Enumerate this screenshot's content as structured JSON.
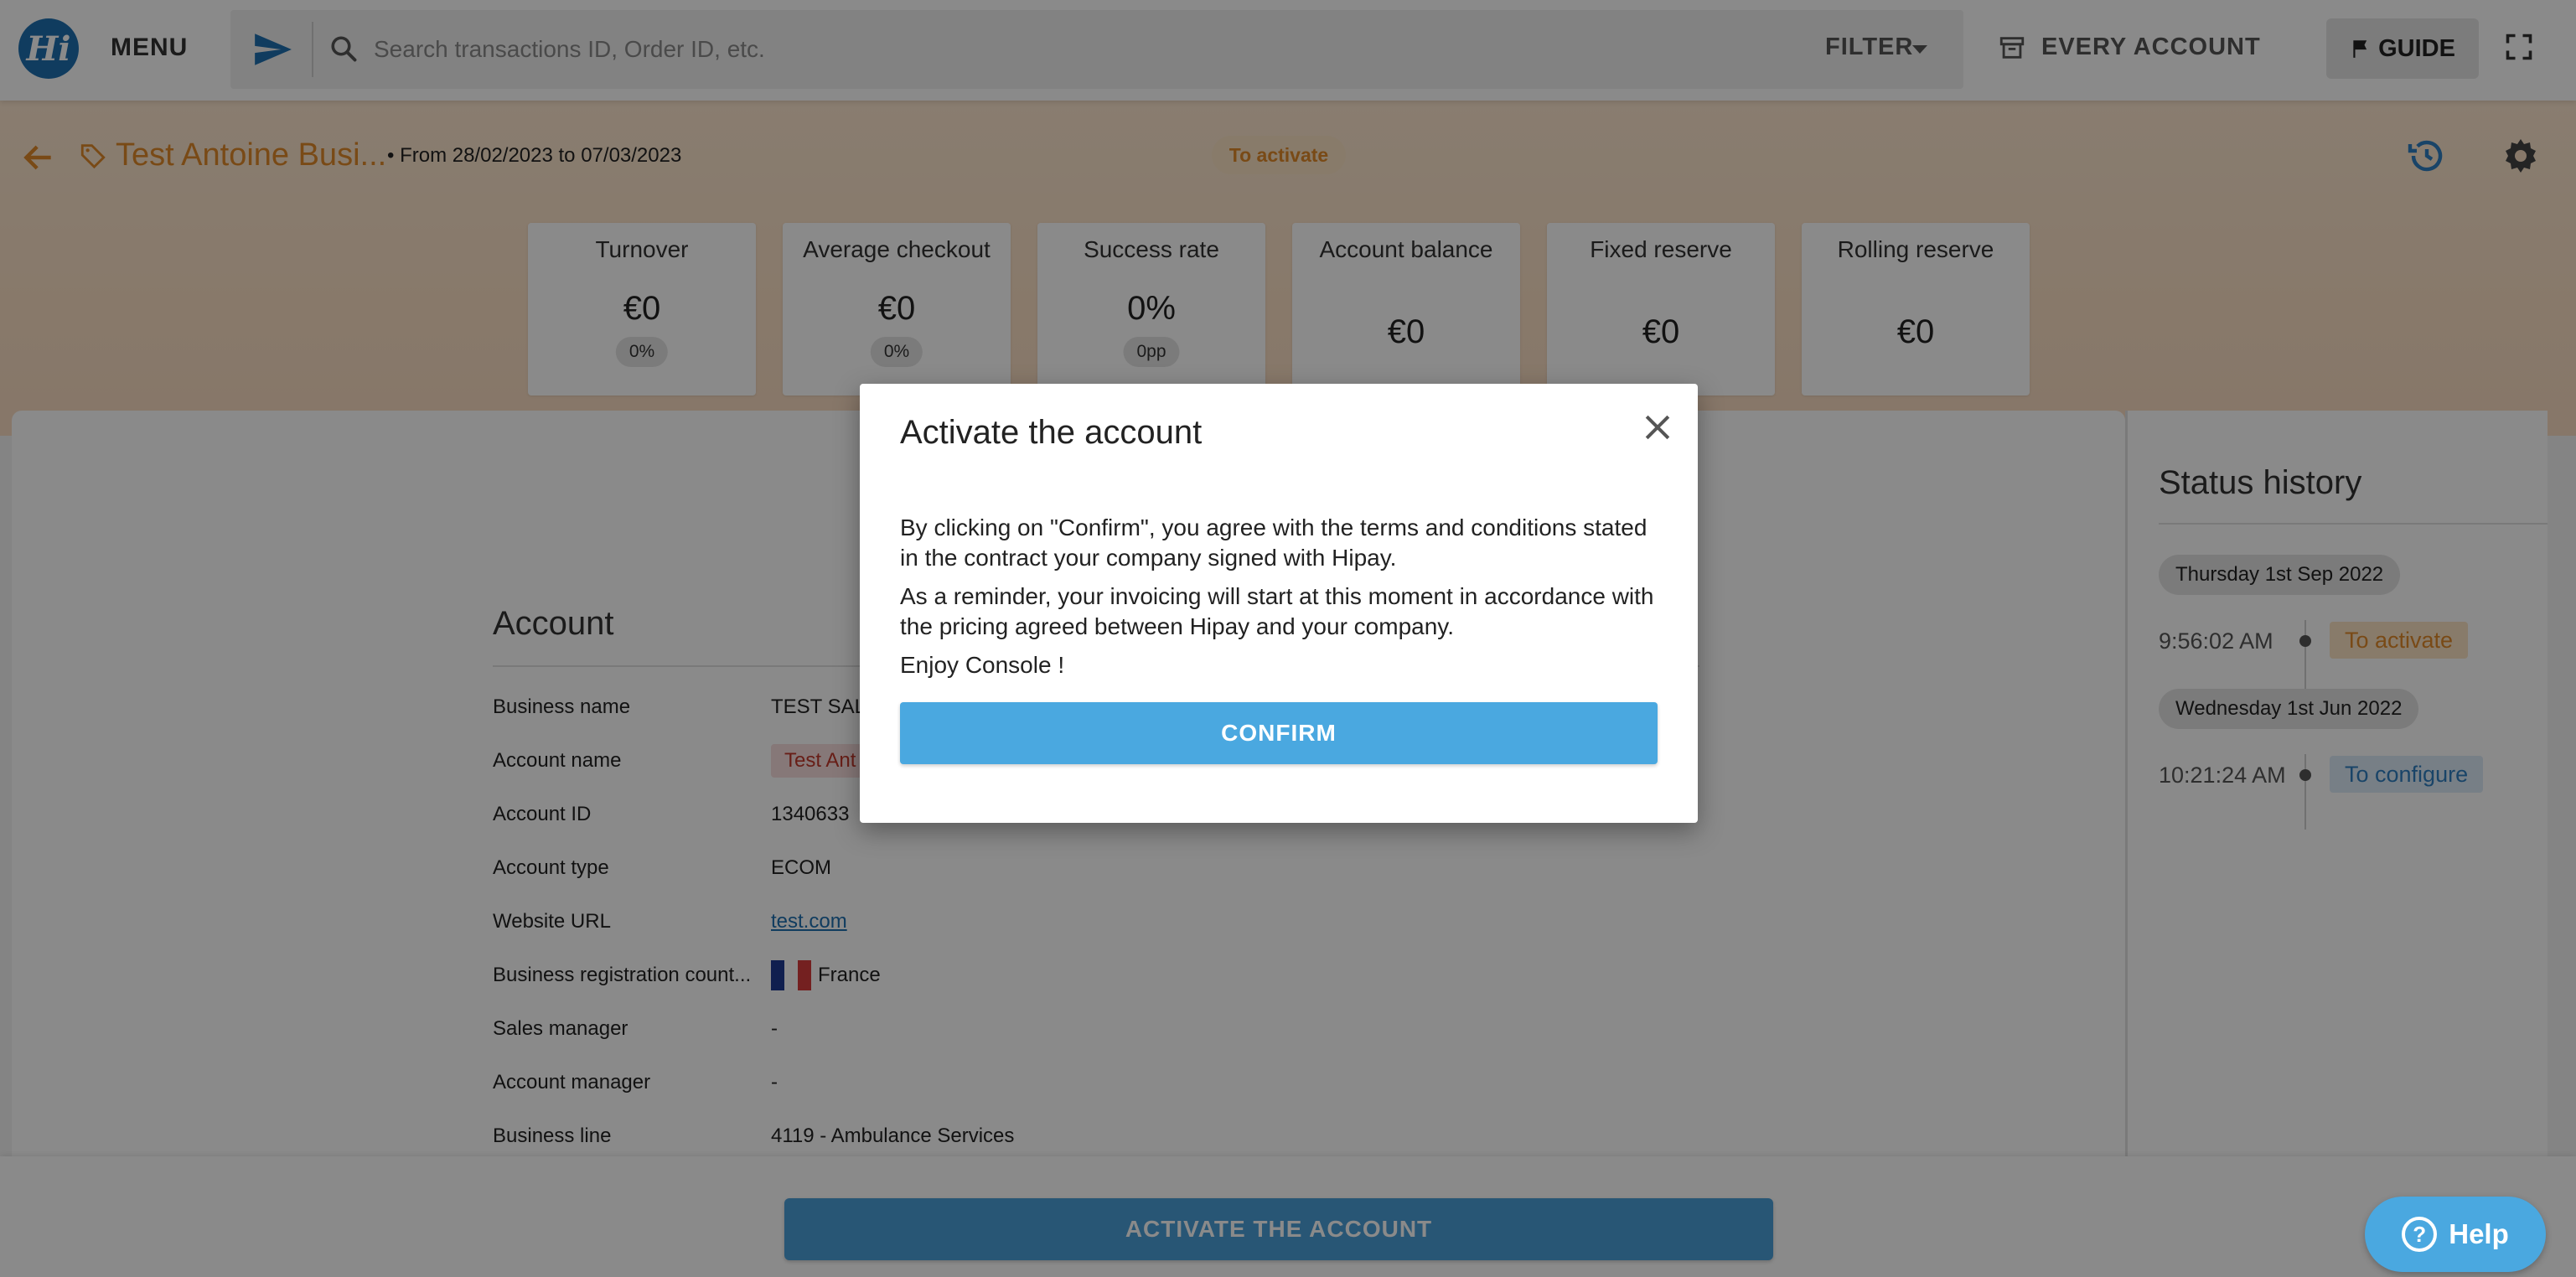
{
  "topbar": {
    "logo_text": "Hi",
    "menu_label": "MENU",
    "search_placeholder": "Search transactions ID, Order ID, etc.",
    "filter_label": "FILTER",
    "every_account_label": "EVERY ACCOUNT",
    "guide_label": "GUIDE"
  },
  "header": {
    "title": "Test Antoine Busi...",
    "date_range": "• From 28/02/2023 to 07/03/2023",
    "status": "To activate"
  },
  "kpis": [
    {
      "label": "Turnover",
      "value": "€0",
      "chip": "0%"
    },
    {
      "label": "Average checkout",
      "value": "€0",
      "chip": "0%"
    },
    {
      "label": "Success rate",
      "value": "0%",
      "chip": "0pp"
    },
    {
      "label": "Account balance",
      "value": "€0"
    },
    {
      "label": "Fixed reserve",
      "value": "€0"
    },
    {
      "label": "Rolling reserve",
      "value": "€0"
    }
  ],
  "account": {
    "title": "Account",
    "rows": [
      {
        "label": "Business name",
        "value": "TEST SAL"
      },
      {
        "label": "Account name",
        "value": "Test Ant"
      },
      {
        "label": "Account ID",
        "value": "1340633"
      },
      {
        "label": "Account type",
        "value": "ECOM"
      },
      {
        "label": "Website URL",
        "value": "test.com"
      },
      {
        "label": "Business registration count...",
        "value": "France"
      },
      {
        "label": "Sales manager",
        "value": "-"
      },
      {
        "label": "Account manager",
        "value": "-"
      },
      {
        "label": "Business line",
        "value": "4119 - Ambulance Services"
      }
    ]
  },
  "status_history": {
    "title": "Status history",
    "entries": [
      {
        "date": "Thursday 1st Sep 2022",
        "time": "9:56:02 AM",
        "status": "To activate"
      },
      {
        "date": "Wednesday 1st Jun 2022",
        "time": "10:21:24 AM",
        "status": "To configure"
      }
    ]
  },
  "bottom": {
    "activate_label": "ACTIVATE THE ACCOUNT"
  },
  "help": {
    "label": "Help"
  },
  "modal": {
    "title": "Activate the account",
    "paragraph1": "By clicking on \"Confirm\", you agree with the terms and conditions stated in the contract your company signed with Hipay.",
    "paragraph2": "As a reminder, your invoicing will start at this moment in accordance with the pricing agreed between Hipay and your company.",
    "paragraph3": "Enjoy Console !",
    "confirm_label": "CONFIRM"
  },
  "colors": {
    "brand": "#1e6fb0",
    "accent_orange": "#e0892a",
    "primary_button": "#4aa8e0"
  }
}
